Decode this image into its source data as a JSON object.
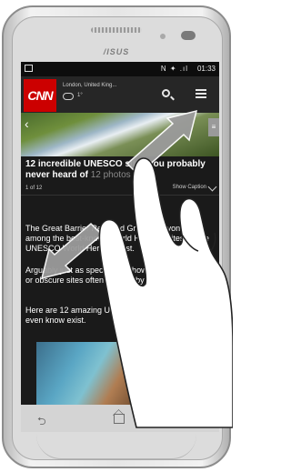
{
  "device": {
    "brand": "/ISUS"
  },
  "status_bar": {
    "time": "01:33",
    "icons": "N ✦ .ıl"
  },
  "app": {
    "logo": "CNN",
    "location": "London, United King...",
    "temperature": "1°"
  },
  "article": {
    "headline_main": "12 incredible UNESCO sites you probably never heard of",
    "headline_count": "12 photos",
    "counter": "1 of 12",
    "show_caption": "Show Caption",
    "hero_grid_glyph": "≡",
    "paragraph_1": "The Great Barrier Reef and Grand Canyon are among the best-known World Heritage sites on the UNESCO World Heritage List.",
    "paragraph_2": "Arguably just as spectacular, however, are unknown or obscure sites often ignored by world travelers.",
    "paragraph_3": "Here are 12 amazing UNESCO sites you might not even know exist."
  },
  "navbar": {
    "back_glyph": "⮌"
  },
  "gesture": {
    "type": "pinch-zoom",
    "skin_color": "#ffffff",
    "arrow_color": "#9b9b9b"
  }
}
